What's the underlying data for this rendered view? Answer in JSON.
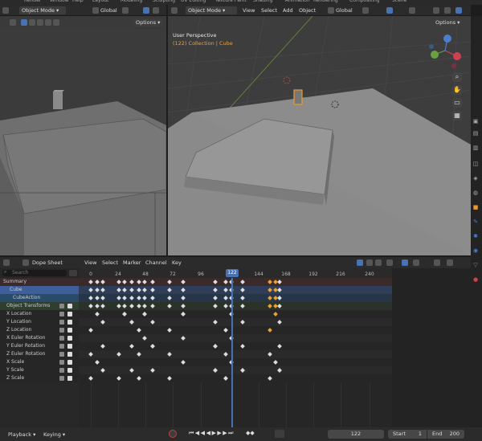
{
  "topbar": {
    "items": [
      "Render",
      "Window",
      "Help",
      "Layout",
      "Modeling",
      "Sculpting",
      "UV Editing",
      "Texture Paint",
      "Shading",
      "Animation",
      "Rendering",
      "Compositing",
      "Scene"
    ]
  },
  "left_viewport": {
    "mode": "Object Mode",
    "transform": "Global",
    "options": "Options"
  },
  "main_viewport": {
    "mode": "Object Mode",
    "menus": [
      "View",
      "Select",
      "Add",
      "Object"
    ],
    "transform": "Global",
    "options": "Options",
    "perspective": "User Perspective",
    "collection_info": "(122) Collection | Cube",
    "gizmo": {
      "x": "X",
      "y": "Y",
      "z": "Z"
    }
  },
  "dopesheet": {
    "editor": "Dope Sheet",
    "menus": [
      "View",
      "Select",
      "Marker",
      "Channel",
      "Key"
    ],
    "search_placeholder": "Search",
    "frame_ticks": [
      "0",
      "24",
      "48",
      "72",
      "96",
      "122",
      "144",
      "168",
      "192",
      "216",
      "240"
    ],
    "current_frame": "122",
    "channels": [
      {
        "label": "Summary",
        "kind": "summary"
      },
      {
        "label": "Cube",
        "kind": "object"
      },
      {
        "label": "CubeAction",
        "kind": "action"
      },
      {
        "label": "Object Transforms",
        "kind": "group"
      },
      {
        "label": "X Location",
        "kind": "fcurve"
      },
      {
        "label": "Y Location",
        "kind": "fcurve"
      },
      {
        "label": "Z Location",
        "kind": "fcurve"
      },
      {
        "label": "X Euler Rotation",
        "kind": "fcurve"
      },
      {
        "label": "Y Euler Rotation",
        "kind": "fcurve"
      },
      {
        "label": "Z Euler Rotation",
        "kind": "fcurve"
      },
      {
        "label": "X Scale",
        "kind": "fcurve"
      },
      {
        "label": "Y Scale",
        "kind": "fcurve"
      },
      {
        "label": "Z Scale",
        "kind": "fcurve"
      }
    ]
  },
  "footer": {
    "playback": "Playback",
    "keying": "Keying",
    "current": "122",
    "start_label": "Start",
    "start": "1",
    "end_label": "End",
    "end": "200"
  }
}
